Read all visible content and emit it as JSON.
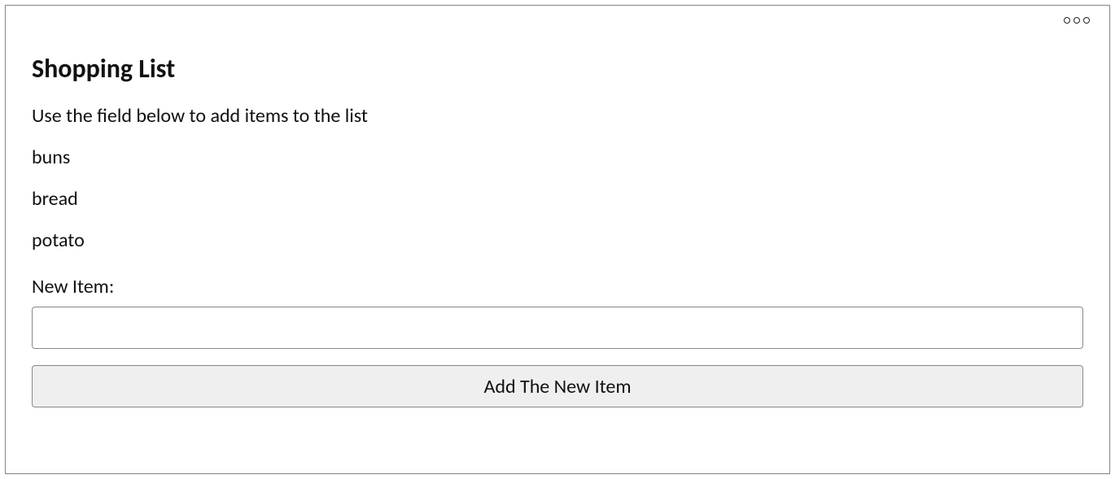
{
  "card": {
    "title": "Shopping List",
    "subtitle": "Use the field below to add items to the list",
    "items": [
      "buns",
      "bread",
      "potato"
    ],
    "new_item_label": "New Item:",
    "new_item_value": "",
    "add_button_label": "Add The New Item"
  }
}
